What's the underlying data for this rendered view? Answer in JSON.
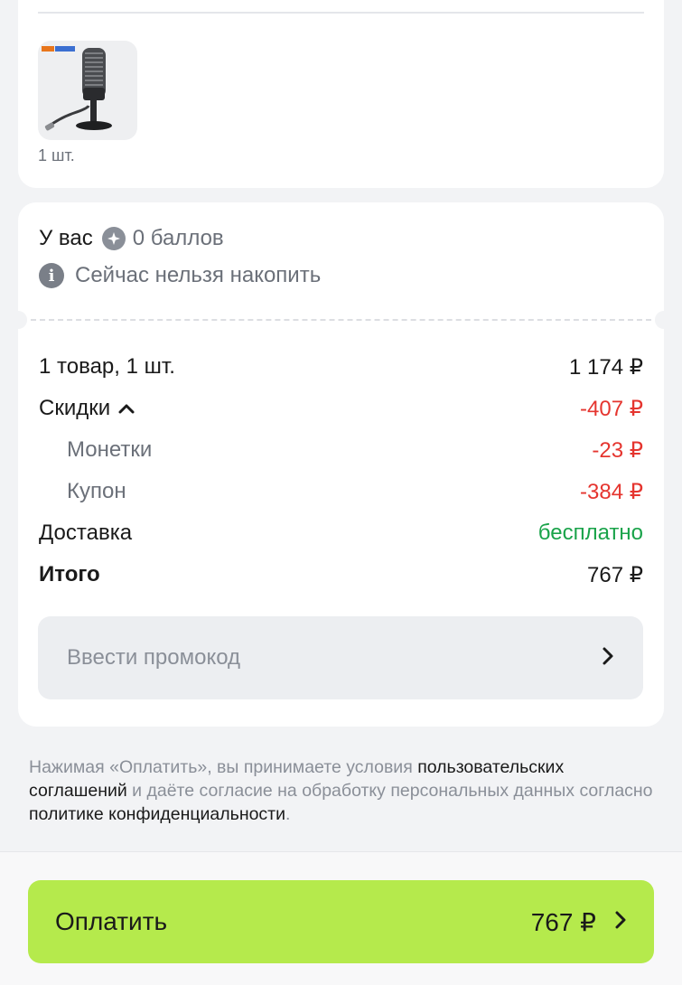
{
  "product": {
    "quantity": "1 шт."
  },
  "points": {
    "label": "У вас",
    "value": "0 баллов",
    "info": "Сейчас нельзя накопить"
  },
  "summary": {
    "items_label": "1 товар, 1 шт.",
    "items_value": "1 174 ₽",
    "discounts_label": "Скидки",
    "discounts_value": "-407 ₽",
    "coins_label": "Монетки",
    "coins_value": "-23 ₽",
    "coupon_label": "Купон",
    "coupon_value": "-384 ₽",
    "delivery_label": "Доставка",
    "delivery_value": "бесплатно",
    "total_label": "Итого",
    "total_value": "767 ₽"
  },
  "promo": {
    "placeholder": "Ввести промокод"
  },
  "legal": {
    "part1": "Нажимая «Оплатить», вы принимаете условия ",
    "link1": "пользовательских соглашений",
    "part2": " и даёте согласие на обработку персональных данных согласно ",
    "link2": "политике конфиденциальности",
    "part3": "."
  },
  "pay": {
    "label": "Оплатить",
    "amount": "767 ₽"
  },
  "colors": {
    "accent_green": "#b5ea4c",
    "discount_red": "#e5352f",
    "free_green": "#1aa34a"
  }
}
